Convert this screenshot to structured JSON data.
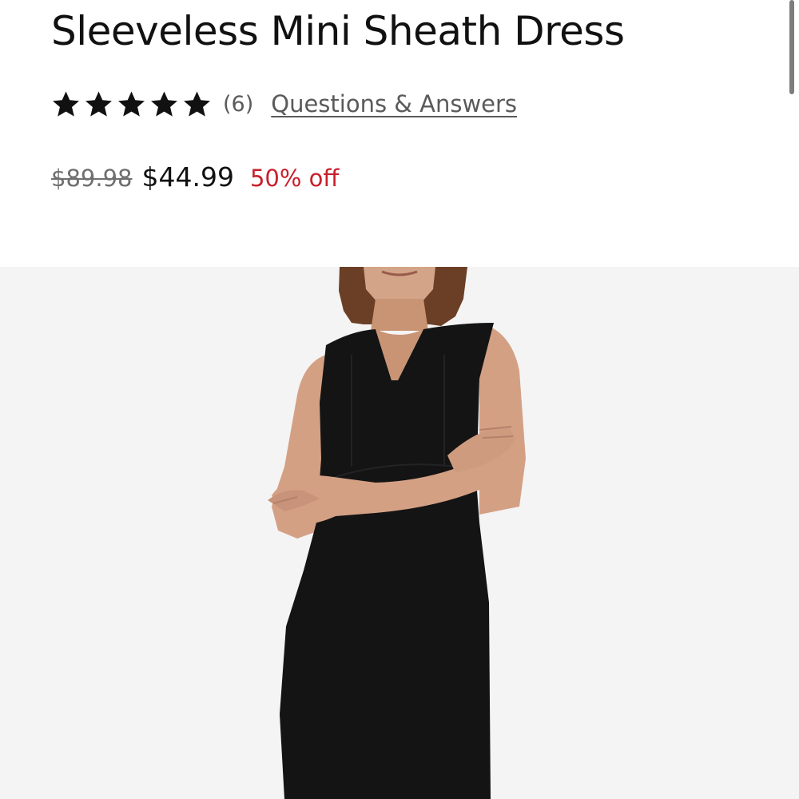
{
  "product": {
    "title": "Sleeveless Mini Sheath Dress",
    "rating": {
      "stars": 5,
      "review_count": "(6)",
      "qa_label": "Questions & Answers"
    },
    "price": {
      "original": "$89.98",
      "sale": "$44.99",
      "discount": "50% off"
    },
    "image": {
      "icon": "product-photo",
      "alt": ""
    }
  },
  "colors": {
    "text": "#111111",
    "muted": "#5a5a5a",
    "discount": "#c8202c",
    "image_bg": "#f4f4f4"
  }
}
